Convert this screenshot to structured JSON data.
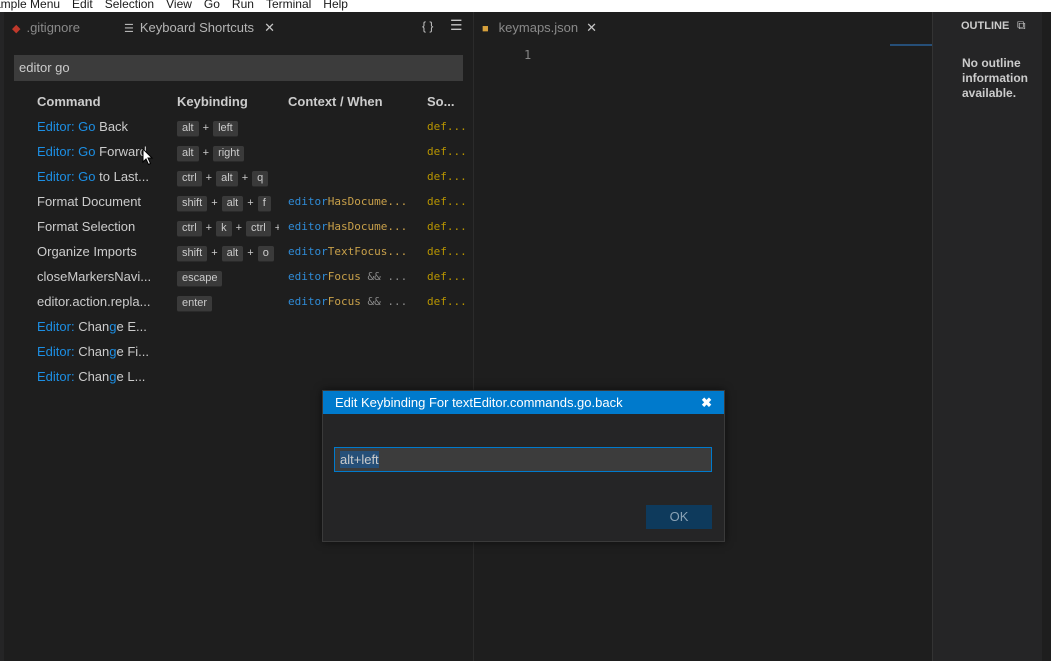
{
  "menubar": {
    "items": [
      "ample Menu",
      "Edit",
      "Selection",
      "View",
      "Go",
      "Run",
      "Terminal",
      "Help"
    ]
  },
  "left_tabs": [
    {
      "label": ".gitignore",
      "icon": "git-diamond-icon"
    },
    {
      "label": "Keyboard Shortcuts",
      "icon": "list-icon"
    }
  ],
  "tab_actions": {
    "json": "{ }",
    "list": "☰"
  },
  "search": {
    "value": "editor go"
  },
  "table": {
    "headers": [
      "Command",
      "Keybinding",
      "Context / When",
      "So..."
    ],
    "rows": [
      {
        "cmd_hl": "Editor: Go",
        "cmd_rest": " Back",
        "keys": [
          "alt",
          "left"
        ],
        "ctx_a": "",
        "ctx_b": "",
        "source": "def..."
      },
      {
        "cmd_hl": "Editor: Go",
        "cmd_rest": " Forward",
        "keys": [
          "alt",
          "right"
        ],
        "ctx_a": "",
        "ctx_b": "",
        "source": "def..."
      },
      {
        "cmd_hl": "Editor: Go",
        "cmd_rest": " to Last...",
        "keys": [
          "ctrl",
          "alt",
          "q"
        ],
        "ctx_a": "",
        "ctx_b": "",
        "source": "def..."
      },
      {
        "cmd_hl": "",
        "cmd_rest": "Format Document",
        "keys": [
          "shift",
          "alt",
          "f"
        ],
        "ctx_a": "editor",
        "ctx_b": "HasDocume...",
        "source": "def..."
      },
      {
        "cmd_hl": "",
        "cmd_rest": "Format Selection",
        "keys": [
          "ctrl",
          "k",
          "ctrl"
        ],
        "ctx_a": "editor",
        "ctx_b": "HasDocume...",
        "source": "def..."
      },
      {
        "cmd_hl": "",
        "cmd_rest": "Organize Imports",
        "keys": [
          "shift",
          "alt",
          "o"
        ],
        "ctx_a": "editor",
        "ctx_b": "TextFocus...",
        "source": "def..."
      },
      {
        "cmd_hl": "",
        "cmd_rest": "closeMarkersNavi...",
        "keys": [
          "escape"
        ],
        "ctx_a": "editor",
        "ctx_b": "Focus && ...",
        "source": "def..."
      },
      {
        "cmd_hl": "",
        "cmd_rest": "editor.action.repla...",
        "keys": [
          "enter"
        ],
        "ctx_a": "editor",
        "ctx_b": "Focus && ...",
        "source": "def..."
      },
      {
        "cmd_hl": "Editor:",
        "cmd_mid": " Chan",
        "cmd_g": "g",
        "cmd_rest": "e E...",
        "keys": [],
        "source": ""
      },
      {
        "cmd_hl": "Editor:",
        "cmd_mid": " Chan",
        "cmd_g": "g",
        "cmd_rest": "e Fi...",
        "keys": [],
        "source": ""
      },
      {
        "cmd_hl": "Editor:",
        "cmd_mid": " Chan",
        "cmd_g": "g",
        "cmd_rest": "e L...",
        "keys": [],
        "source": ""
      }
    ]
  },
  "editor_tab": {
    "label": "keymaps.json",
    "icon": "json-file-icon"
  },
  "editor": {
    "line_number": "1"
  },
  "outline": {
    "title": "OUTLINE",
    "message": "No outline information available."
  },
  "dialog": {
    "title": "Edit Keybinding For textEditor.commands.go.back",
    "close": "✖",
    "input_value": "alt+left",
    "ok_label": "OK"
  },
  "colors": {
    "accent": "#007acc",
    "highlight": "#1c8fe4",
    "source": "#b89500"
  }
}
